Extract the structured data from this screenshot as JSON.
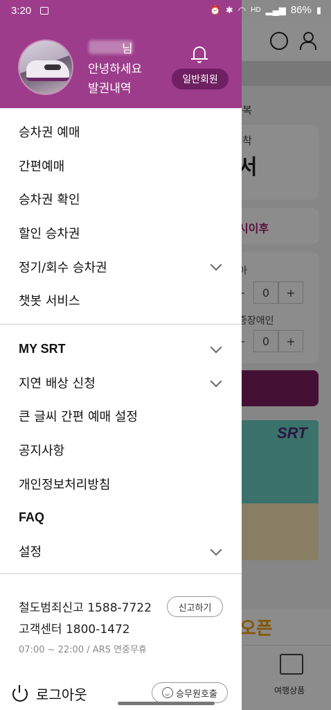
{
  "status_bar": {
    "time": "3:20",
    "battery": "86%",
    "network": "HD"
  },
  "background": {
    "labels": [
      "복",
      "착",
      "서",
      "시이후",
      "아",
      "증장애인"
    ],
    "stepper_value_1": "0",
    "stepper_value_2": "0",
    "minus": "−",
    "plus": "+",
    "promo_brand": "SRT",
    "promo_open": "오픈",
    "nav_travel": "여행상품"
  },
  "profile": {
    "name_suffix": "님",
    "greeting": "안녕하세요",
    "tickets_link": "발권내역",
    "member_badge": "일반회원"
  },
  "menu_primary": [
    {
      "label": "승차권 예매",
      "chevron": false
    },
    {
      "label": "간편예매",
      "chevron": false
    },
    {
      "label": "승차권 확인",
      "chevron": false
    },
    {
      "label": "할인 승차권",
      "chevron": false
    },
    {
      "label": "정기/회수 승차권",
      "chevron": true
    },
    {
      "label": "챗봇 서비스",
      "chevron": false
    }
  ],
  "menu_secondary": [
    {
      "label": "MY SRT",
      "chevron": true
    },
    {
      "label": "지연 배상 신청",
      "chevron": true
    },
    {
      "label": "큰 글씨 간편 예매 설정",
      "chevron": false
    },
    {
      "label": "공지사항",
      "chevron": false
    },
    {
      "label": "개인정보처리방침",
      "chevron": false
    },
    {
      "label": "FAQ",
      "chevron": false
    },
    {
      "label": "설정",
      "chevron": true
    }
  ],
  "contact": {
    "crime_report": "철도범죄신고 1588-7722",
    "report_button": "신고하기",
    "customer_center": "고객센터 1800-1472",
    "hours": "07:00 ~ 22:00 / ARS 연중무휴"
  },
  "footer": {
    "logout": "로그아웃",
    "call_crew": "승무원호출"
  }
}
